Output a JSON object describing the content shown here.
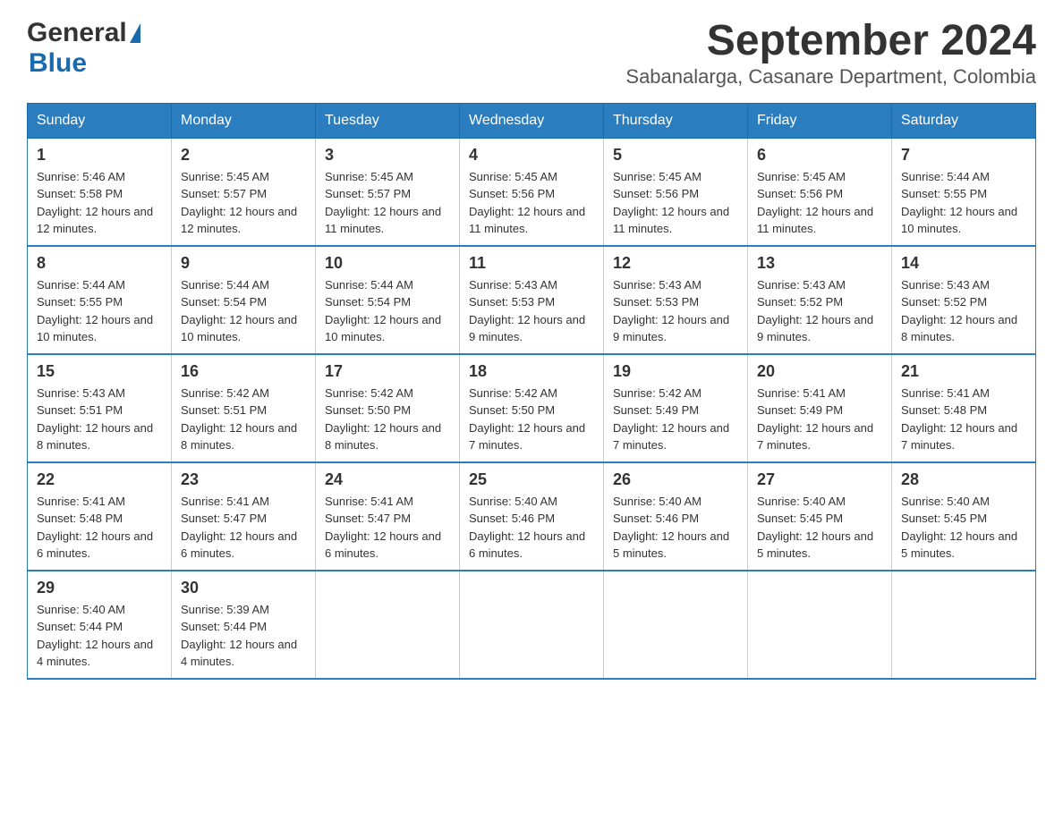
{
  "header": {
    "logo_general": "General",
    "logo_arrow": "▶",
    "logo_blue": "Blue",
    "month_year": "September 2024",
    "location": "Sabanalarga, Casanare Department, Colombia"
  },
  "days_of_week": [
    "Sunday",
    "Monday",
    "Tuesday",
    "Wednesday",
    "Thursday",
    "Friday",
    "Saturday"
  ],
  "weeks": [
    [
      {
        "day": "1",
        "sunrise": "5:46 AM",
        "sunset": "5:58 PM",
        "daylight": "12 hours and 12 minutes."
      },
      {
        "day": "2",
        "sunrise": "5:45 AM",
        "sunset": "5:57 PM",
        "daylight": "12 hours and 12 minutes."
      },
      {
        "day": "3",
        "sunrise": "5:45 AM",
        "sunset": "5:57 PM",
        "daylight": "12 hours and 11 minutes."
      },
      {
        "day": "4",
        "sunrise": "5:45 AM",
        "sunset": "5:56 PM",
        "daylight": "12 hours and 11 minutes."
      },
      {
        "day": "5",
        "sunrise": "5:45 AM",
        "sunset": "5:56 PM",
        "daylight": "12 hours and 11 minutes."
      },
      {
        "day": "6",
        "sunrise": "5:45 AM",
        "sunset": "5:56 PM",
        "daylight": "12 hours and 11 minutes."
      },
      {
        "day": "7",
        "sunrise": "5:44 AM",
        "sunset": "5:55 PM",
        "daylight": "12 hours and 10 minutes."
      }
    ],
    [
      {
        "day": "8",
        "sunrise": "5:44 AM",
        "sunset": "5:55 PM",
        "daylight": "12 hours and 10 minutes."
      },
      {
        "day": "9",
        "sunrise": "5:44 AM",
        "sunset": "5:54 PM",
        "daylight": "12 hours and 10 minutes."
      },
      {
        "day": "10",
        "sunrise": "5:44 AM",
        "sunset": "5:54 PM",
        "daylight": "12 hours and 10 minutes."
      },
      {
        "day": "11",
        "sunrise": "5:43 AM",
        "sunset": "5:53 PM",
        "daylight": "12 hours and 9 minutes."
      },
      {
        "day": "12",
        "sunrise": "5:43 AM",
        "sunset": "5:53 PM",
        "daylight": "12 hours and 9 minutes."
      },
      {
        "day": "13",
        "sunrise": "5:43 AM",
        "sunset": "5:52 PM",
        "daylight": "12 hours and 9 minutes."
      },
      {
        "day": "14",
        "sunrise": "5:43 AM",
        "sunset": "5:52 PM",
        "daylight": "12 hours and 8 minutes."
      }
    ],
    [
      {
        "day": "15",
        "sunrise": "5:43 AM",
        "sunset": "5:51 PM",
        "daylight": "12 hours and 8 minutes."
      },
      {
        "day": "16",
        "sunrise": "5:42 AM",
        "sunset": "5:51 PM",
        "daylight": "12 hours and 8 minutes."
      },
      {
        "day": "17",
        "sunrise": "5:42 AM",
        "sunset": "5:50 PM",
        "daylight": "12 hours and 8 minutes."
      },
      {
        "day": "18",
        "sunrise": "5:42 AM",
        "sunset": "5:50 PM",
        "daylight": "12 hours and 7 minutes."
      },
      {
        "day": "19",
        "sunrise": "5:42 AM",
        "sunset": "5:49 PM",
        "daylight": "12 hours and 7 minutes."
      },
      {
        "day": "20",
        "sunrise": "5:41 AM",
        "sunset": "5:49 PM",
        "daylight": "12 hours and 7 minutes."
      },
      {
        "day": "21",
        "sunrise": "5:41 AM",
        "sunset": "5:48 PM",
        "daylight": "12 hours and 7 minutes."
      }
    ],
    [
      {
        "day": "22",
        "sunrise": "5:41 AM",
        "sunset": "5:48 PM",
        "daylight": "12 hours and 6 minutes."
      },
      {
        "day": "23",
        "sunrise": "5:41 AM",
        "sunset": "5:47 PM",
        "daylight": "12 hours and 6 minutes."
      },
      {
        "day": "24",
        "sunrise": "5:41 AM",
        "sunset": "5:47 PM",
        "daylight": "12 hours and 6 minutes."
      },
      {
        "day": "25",
        "sunrise": "5:40 AM",
        "sunset": "5:46 PM",
        "daylight": "12 hours and 6 minutes."
      },
      {
        "day": "26",
        "sunrise": "5:40 AM",
        "sunset": "5:46 PM",
        "daylight": "12 hours and 5 minutes."
      },
      {
        "day": "27",
        "sunrise": "5:40 AM",
        "sunset": "5:45 PM",
        "daylight": "12 hours and 5 minutes."
      },
      {
        "day": "28",
        "sunrise": "5:40 AM",
        "sunset": "5:45 PM",
        "daylight": "12 hours and 5 minutes."
      }
    ],
    [
      {
        "day": "29",
        "sunrise": "5:40 AM",
        "sunset": "5:44 PM",
        "daylight": "12 hours and 4 minutes."
      },
      {
        "day": "30",
        "sunrise": "5:39 AM",
        "sunset": "5:44 PM",
        "daylight": "12 hours and 4 minutes."
      },
      null,
      null,
      null,
      null,
      null
    ]
  ]
}
